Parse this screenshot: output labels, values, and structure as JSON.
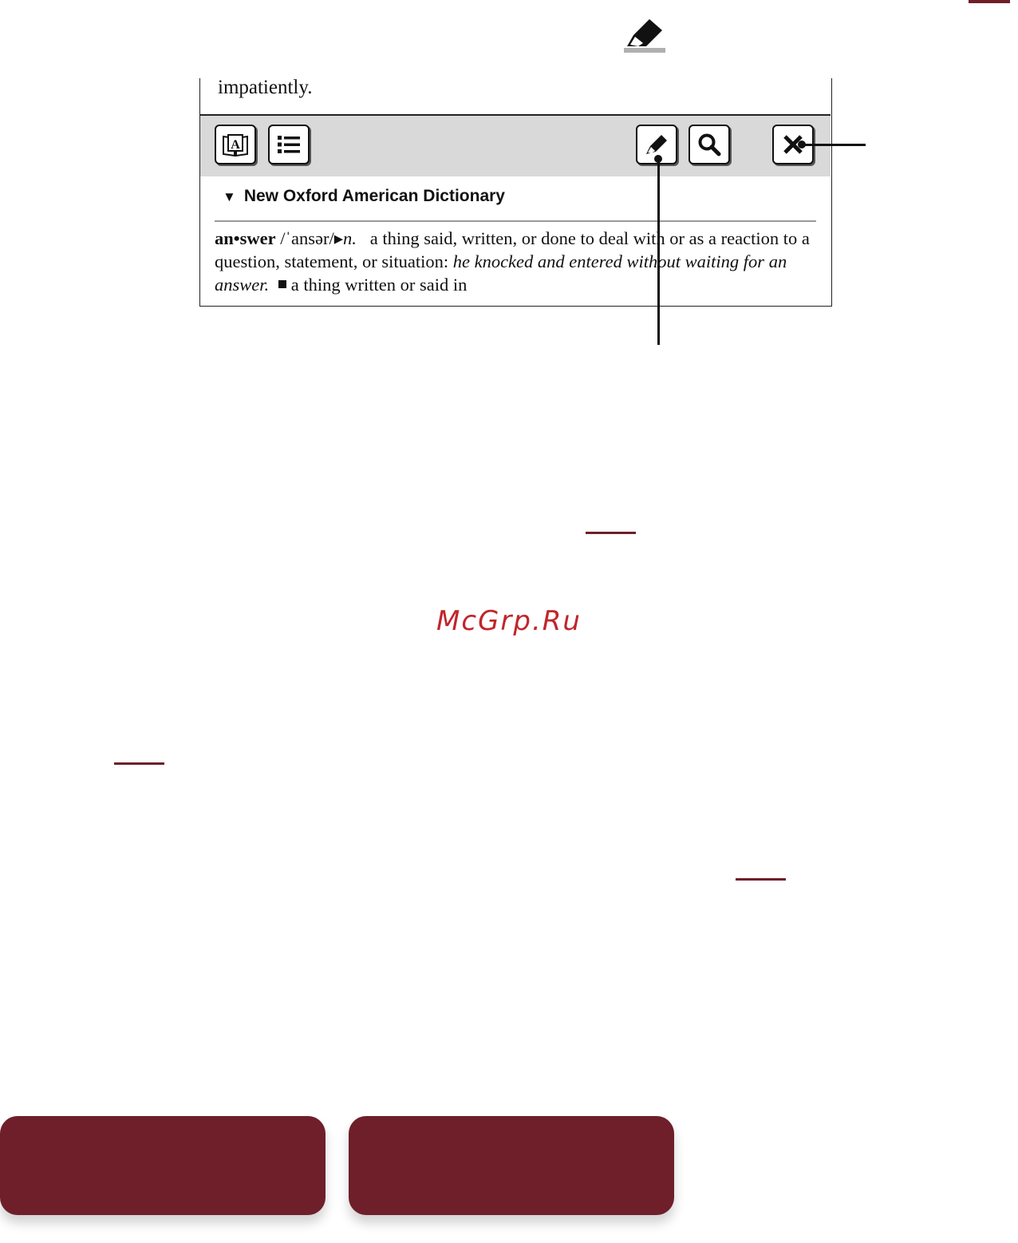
{
  "book_text": "impatiently.",
  "toolbar": {
    "buttons": [
      {
        "icon": "dictionary-icon"
      },
      {
        "icon": "list-icon"
      },
      {
        "icon": "highlight-icon"
      },
      {
        "icon": "search-icon"
      },
      {
        "icon": "close-icon"
      }
    ]
  },
  "dictionary": {
    "name": "New Oxford American Dictionary",
    "headword": "an•swer",
    "pronunciation": "/ˈansər/",
    "part_of_speech": "n.",
    "sense_1": "a thing said, written, or done to deal with or as a reaction to a question, statement, or situation:",
    "example_1": "he knocked and entered without waiting for an answer.",
    "sense_2": "a thing written or said in"
  },
  "watermark": "McGrp.Ru",
  "colors": {
    "accent": "#6e1f2a",
    "watermark": "#c0262b",
    "toolbar_bg": "#d9d9d9"
  }
}
